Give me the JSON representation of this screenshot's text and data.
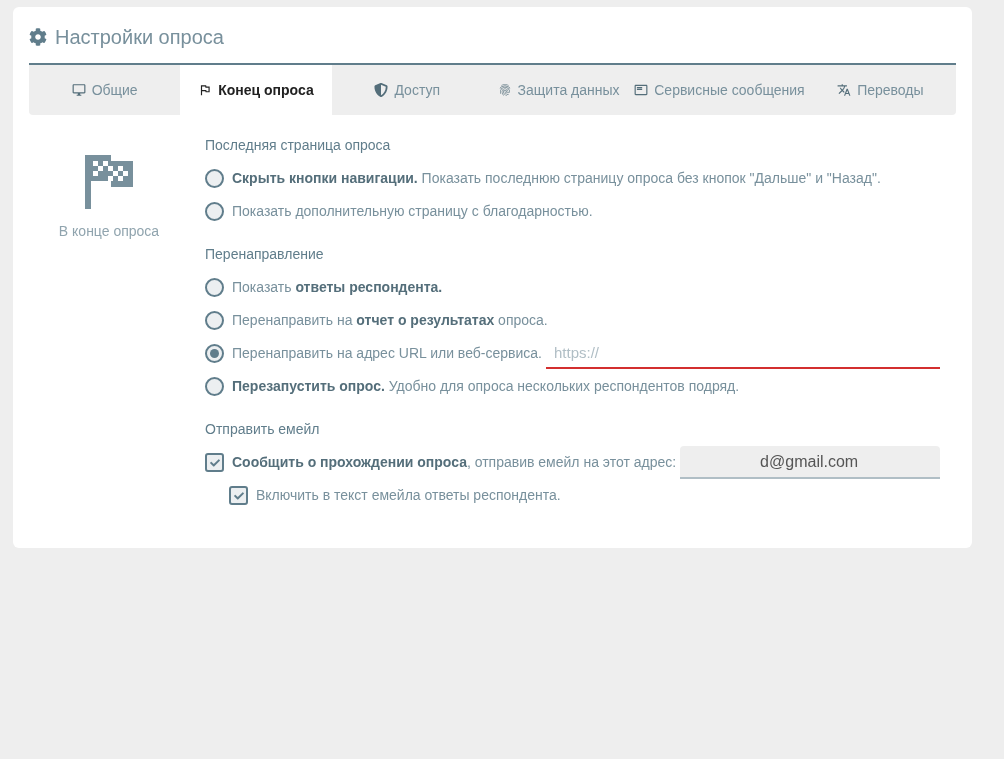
{
  "panel": {
    "title": "Настройки опроса"
  },
  "tabs": [
    {
      "label": "Общие",
      "selected": false
    },
    {
      "label": "Конец опроса",
      "selected": true
    },
    {
      "label": "Доступ",
      "selected": false
    },
    {
      "label": "Защита данных",
      "selected": false
    },
    {
      "label": "Сервисные сообщения",
      "selected": false
    },
    {
      "label": "Переводы",
      "selected": false
    }
  ],
  "side": {
    "caption": "В конце опроса"
  },
  "sections": [
    {
      "title": "Последняя страница опроса",
      "options": [
        {
          "kind": "radio",
          "label": "**Скрыть кнопки навигации.** Показать последнюю страницу опроса без кнопок \"Дальше\" и \"Назад\".",
          "selected": false
        },
        {
          "kind": "radio",
          "label": "Показать дополнительную страницу с благодарностью.",
          "selected": false
        }
      ]
    },
    {
      "title": "Перенаправление",
      "options": [
        {
          "kind": "radio",
          "label": "Показать **ответы респондента.**",
          "selected": false
        },
        {
          "kind": "radio",
          "label": "Перенаправить на **отчет о результатах** опроса.",
          "selected": false
        },
        {
          "kind": "radio",
          "label": "Перенаправить на адрес URL или веб-сервиса.",
          "selected": true,
          "field": {
            "kind": "url",
            "placeholder": "https://",
            "invalid": true
          }
        },
        {
          "kind": "radio",
          "label": "**Перезапустить опрос.** Удобно для опроса нескольких респондентов подряд.",
          "selected": false
        }
      ]
    },
    {
      "title": "Отправить емейл",
      "options": [
        {
          "kind": "checkbox",
          "label": "**Сообщить о прохождении опроса**, отправив емейл на этот адрес:",
          "checked": true,
          "field": {
            "kind": "email",
            "value": "d@gmail.com",
            "invalid": false
          },
          "children": [
            {
              "kind": "checkbox",
              "label": "Включить в текст емейла ответы респондента.",
              "checked": true
            }
          ]
        }
      ]
    }
  ]
}
